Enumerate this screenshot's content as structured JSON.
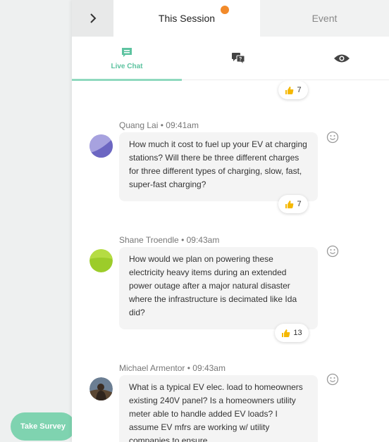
{
  "survey": {
    "label": "Take Survey"
  },
  "tabs": {
    "session": "This Session",
    "event": "Event"
  },
  "subtabs": {
    "live_chat": "Live Chat"
  },
  "top_reaction": {
    "count": "7"
  },
  "messages": [
    {
      "author": "Quang Lai",
      "time": "09:41am",
      "text": "How much it cost to fuel up your EV at charging stations? Will there be three different charges for three different types of charging, slow, fast, super-fast charging?",
      "reaction_count": "7"
    },
    {
      "author": "Shane Troendle",
      "time": "09:43am",
      "text": "How would we plan on powering these electricity heavy items during an extended power outage after a major natural disaster where the infrastructure is decimated like Ida did?",
      "reaction_count": "13"
    },
    {
      "author": "Michael Armentor",
      "time": "09:43am",
      "text": "What is a typical EV elec. load to homeowners existing 240V panel?  Is a homeowners utility meter able to handle added EV loads?  I assume EV mfrs are working w/ utility companies to ensure"
    }
  ],
  "separator": "•"
}
